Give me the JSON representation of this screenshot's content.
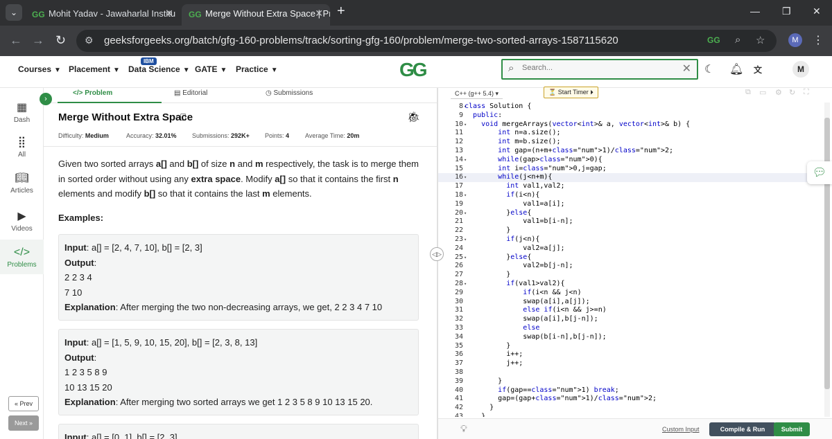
{
  "browser": {
    "tabs": [
      {
        "title": "Mohit Yadav - Jawaharlal Institu",
        "favicon": "GG"
      },
      {
        "title": "Merge Without Extra Space | Pr",
        "favicon": "GG"
      }
    ],
    "url": "geeksforgeeks.org/batch/gfg-160-problems/track/sorting-gfg-160/problem/merge-two-sorted-arrays-1587115620",
    "profile_initial": "M"
  },
  "site": {
    "menu": [
      {
        "label": "Courses"
      },
      {
        "label": "Placement"
      },
      {
        "label": "Data Science",
        "badge": "IBM"
      },
      {
        "label": "GATE"
      },
      {
        "label": "Practice"
      }
    ],
    "logo": "GG",
    "search_placeholder": "Search...",
    "user_initial": "M",
    "accent": "#2f8d46"
  },
  "sidebar": {
    "items": [
      {
        "label": "Dash",
        "icon": "dashboard-icon"
      },
      {
        "label": "All",
        "icon": "grid-icon"
      },
      {
        "label": "Articles",
        "icon": "book-icon"
      },
      {
        "label": "Videos",
        "icon": "play-icon"
      },
      {
        "label": "Problems",
        "icon": "code-icon",
        "active": true
      }
    ],
    "prev_label": "« Prev",
    "next_label": "Next »"
  },
  "problem": {
    "tabs": [
      "Problem",
      "Editorial",
      "Submissions"
    ],
    "title": "Merge Without Extra Space",
    "meta": [
      {
        "label": "Difficulty:",
        "value": "Medium"
      },
      {
        "label": "Accuracy:",
        "value": "32.01%"
      },
      {
        "label": "Submissions:",
        "value": "292K+"
      },
      {
        "label": "Points:",
        "value": "4"
      },
      {
        "label": "Average Time:",
        "value": "20m"
      }
    ],
    "desc": {
      "p1": "Given two sorted arrays ",
      "a": "a[]",
      "p2": " and ",
      "b": "b[]",
      "p3": " of size ",
      "n": "n",
      "p4": " and ",
      "m": "m",
      "p5": " respectively, the task is to merge them in sorted order without using any ",
      "extra": "extra space",
      "p6": ". Modify ",
      "a2": "a[]",
      "p7": " so that it contains the first ",
      "n2": "n",
      "p8": " elements and modify ",
      "b2": "b[]",
      "p9": " so that it contains the last ",
      "m2": "m",
      "p10": " elements."
    },
    "examples_heading": "Examples:",
    "examples": [
      {
        "input_label": "Input",
        "input": ": a[] = [2, 4, 7, 10], b[] = [2, 3]",
        "output_label": "Output",
        "output_lines": [
          "2 2 3 4",
          "7 10"
        ],
        "explanation_label": "Explanation",
        "explanation": ": After merging the two non-decreasing arrays, we get, 2 2 3 4 7 10"
      },
      {
        "input_label": "Input",
        "input": ": a[] = [1, 5, 9, 10, 15, 20], b[] = [2, 3, 8, 13]",
        "output_label": "Output",
        "output_lines": [
          "1 2 3 5 8 9",
          "10 13 15 20"
        ],
        "explanation_label": "Explanation",
        "explanation": ": After merging two sorted arrays we get 1 2 3 5 8 9 10 13 15 20."
      },
      {
        "input_label": "Input",
        "input": ": a[] = [0, 1], b[] = [2, 3]"
      }
    ]
  },
  "editor": {
    "language": "C++ (g++ 5.4)",
    "timer_label": "Start Timer",
    "custom_input": "Custom Input",
    "compile_run": "Compile & Run",
    "submit": "Submit",
    "lines": [
      {
        "n": "8",
        "fold": true,
        "code": "class Solution {"
      },
      {
        "n": "9",
        "code": "  public:"
      },
      {
        "n": "10",
        "fold": true,
        "code": "    void mergeArrays(vector<int>& a, vector<int>& b) {"
      },
      {
        "n": "11",
        "code": "        int n=a.size();"
      },
      {
        "n": "12",
        "code": "        int m=b.size();"
      },
      {
        "n": "13",
        "code": "        int gap=(n+m+1)/2;"
      },
      {
        "n": "14",
        "fold": true,
        "code": "        while(gap>0){"
      },
      {
        "n": "15",
        "code": "        int i=0,j=gap;"
      },
      {
        "n": "16",
        "fold": true,
        "code": "        while(j<n+m){",
        "active": true
      },
      {
        "n": "17",
        "code": "          int val1,val2;"
      },
      {
        "n": "18",
        "fold": true,
        "code": "          if(i<n){"
      },
      {
        "n": "19",
        "code": "              val1=a[i];"
      },
      {
        "n": "20",
        "fold": true,
        "code": "          }else{"
      },
      {
        "n": "21",
        "code": "              val1=b[i-n];"
      },
      {
        "n": "22",
        "code": "          }"
      },
      {
        "n": "23",
        "fold": true,
        "code": "          if(j<n){"
      },
      {
        "n": "24",
        "code": "              val2=a[j];"
      },
      {
        "n": "25",
        "fold": true,
        "code": "          }else{"
      },
      {
        "n": "26",
        "code": "              val2=b[j-n];"
      },
      {
        "n": "27",
        "code": "          }"
      },
      {
        "n": "28",
        "fold": true,
        "code": "          if(val1>val2){"
      },
      {
        "n": "29",
        "code": "              if(i<n && j<n)"
      },
      {
        "n": "30",
        "code": "              swap(a[i],a[j]);"
      },
      {
        "n": "31",
        "code": "              else if(i<n && j>=n)"
      },
      {
        "n": "32",
        "code": "              swap(a[i],b[j-n]);"
      },
      {
        "n": "33",
        "code": "              else"
      },
      {
        "n": "34",
        "code": "              swap(b[i-n],b[j-n]);"
      },
      {
        "n": "35",
        "code": "          }"
      },
      {
        "n": "36",
        "code": "          i++;"
      },
      {
        "n": "37",
        "code": "          j++;"
      },
      {
        "n": "38",
        "code": ""
      },
      {
        "n": "39",
        "code": "        }"
      },
      {
        "n": "40",
        "code": "        if(gap==1) break;"
      },
      {
        "n": "41",
        "code": "        gap=(gap+1)/2;"
      },
      {
        "n": "42",
        "code": "      }"
      },
      {
        "n": "43",
        "code": "    }"
      }
    ]
  }
}
